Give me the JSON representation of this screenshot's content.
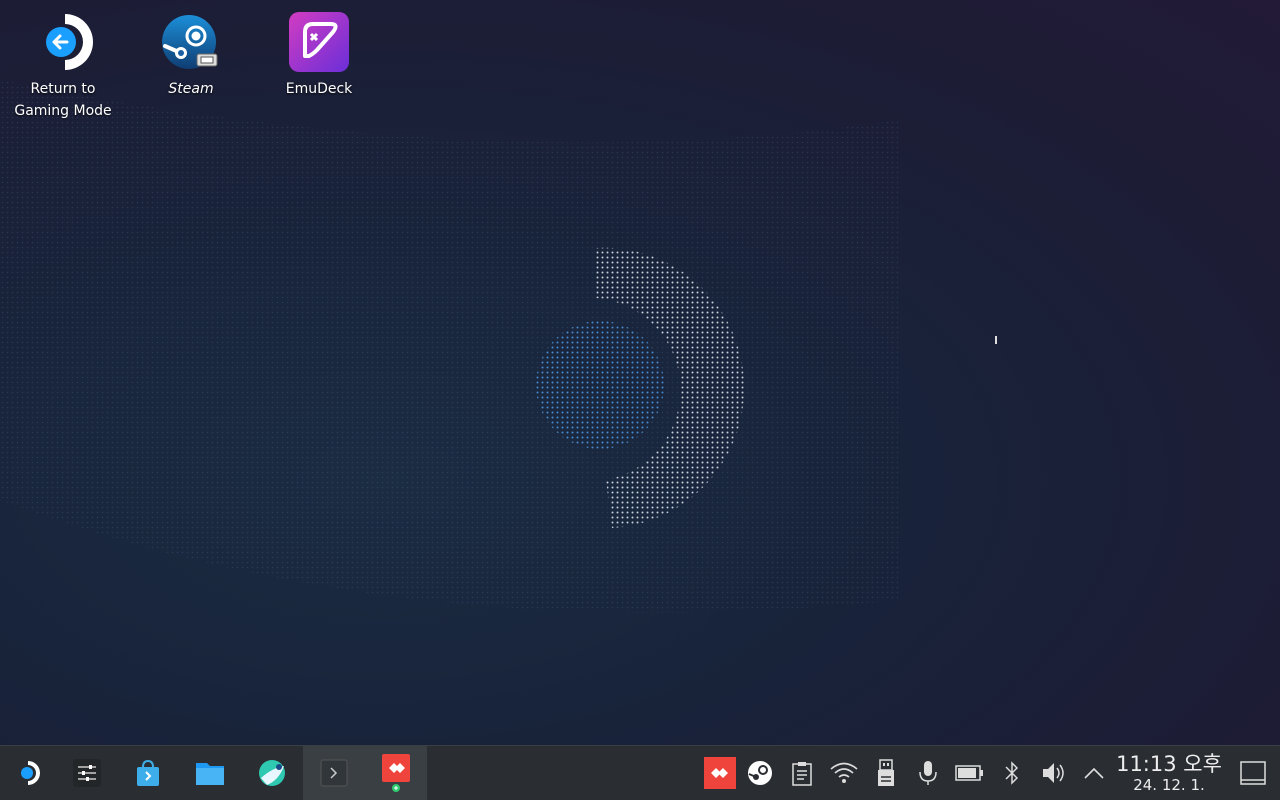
{
  "desktop": {
    "icons": [
      {
        "label_line1": "Return to",
        "label_line2": "Gaming Mode",
        "icon": "return-arrow-icon"
      },
      {
        "label": "Steam",
        "icon": "steam-icon"
      },
      {
        "label": "EmuDeck",
        "icon": "emudeck-icon"
      }
    ]
  },
  "taskbar": {
    "apps": [
      {
        "name": "application-launcher",
        "icon": "steamdeck-logo-icon"
      },
      {
        "name": "system-settings",
        "icon": "sliders-icon"
      },
      {
        "name": "discover",
        "icon": "store-bag-icon"
      },
      {
        "name": "dolphin",
        "icon": "folder-icon"
      },
      {
        "name": "browser",
        "icon": "globe-icon"
      },
      {
        "name": "terminal",
        "icon": "terminal-icon"
      },
      {
        "name": "anydesk",
        "icon": "anydesk-icon"
      }
    ],
    "tray": [
      "anydesk-tray-icon",
      "steam-tray-icon",
      "clipboard-icon",
      "wifi-icon",
      "usb-drive-icon",
      "microphone-icon",
      "battery-icon",
      "bluetooth-icon",
      "volume-icon",
      "expand-tray-icon"
    ],
    "clock": {
      "time": "11:13 오후",
      "date": "24. 12. 1."
    }
  },
  "colors": {
    "accent": "#1a9fff",
    "anydesk": "#ef443b",
    "emudeck": "#9b37d6"
  }
}
